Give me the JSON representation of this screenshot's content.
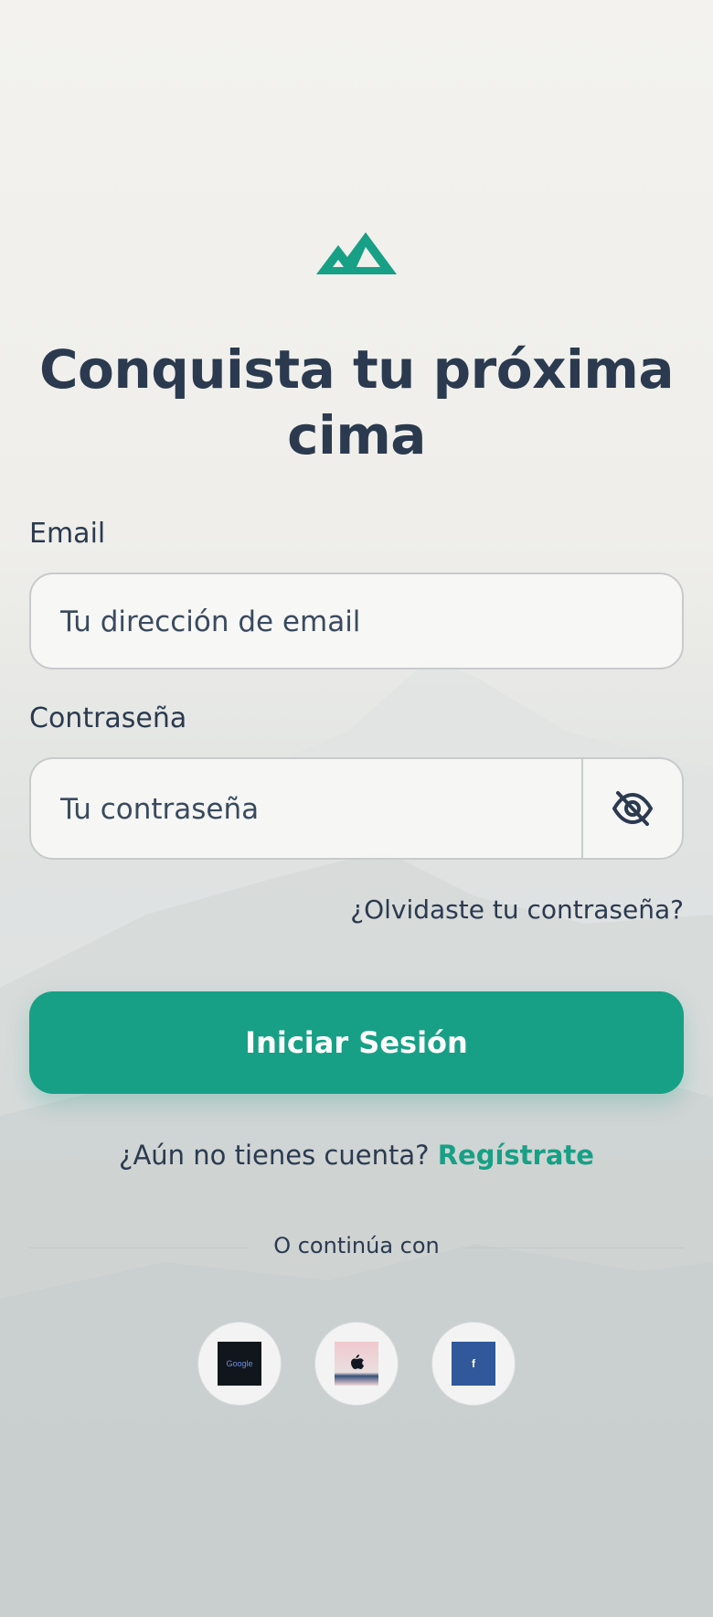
{
  "colors": {
    "accent": "#17a085",
    "text": "#2b3a4f",
    "background_top": "#f3f2ef",
    "background_bottom": "#c9cdcd"
  },
  "logo": {
    "icon": "mountain-logo-icon"
  },
  "headline": "Conquista tu próxima cima",
  "form": {
    "email_label": "Email",
    "email_placeholder": "Tu dirección de email",
    "password_label": "Contraseña",
    "password_placeholder": "Tu contraseña",
    "toggle_icon": "eye-off-icon",
    "forgot_link": "¿Olvidaste tu contraseña?",
    "submit_label": "Iniciar Sesión"
  },
  "signup": {
    "prompt": "¿Aún no tienes cuenta?",
    "link": "Regístrate"
  },
  "divider": {
    "text": "O continúa con"
  },
  "social": {
    "google_text": "Google",
    "apple_icon": "apple-icon",
    "facebook_text": "f"
  }
}
